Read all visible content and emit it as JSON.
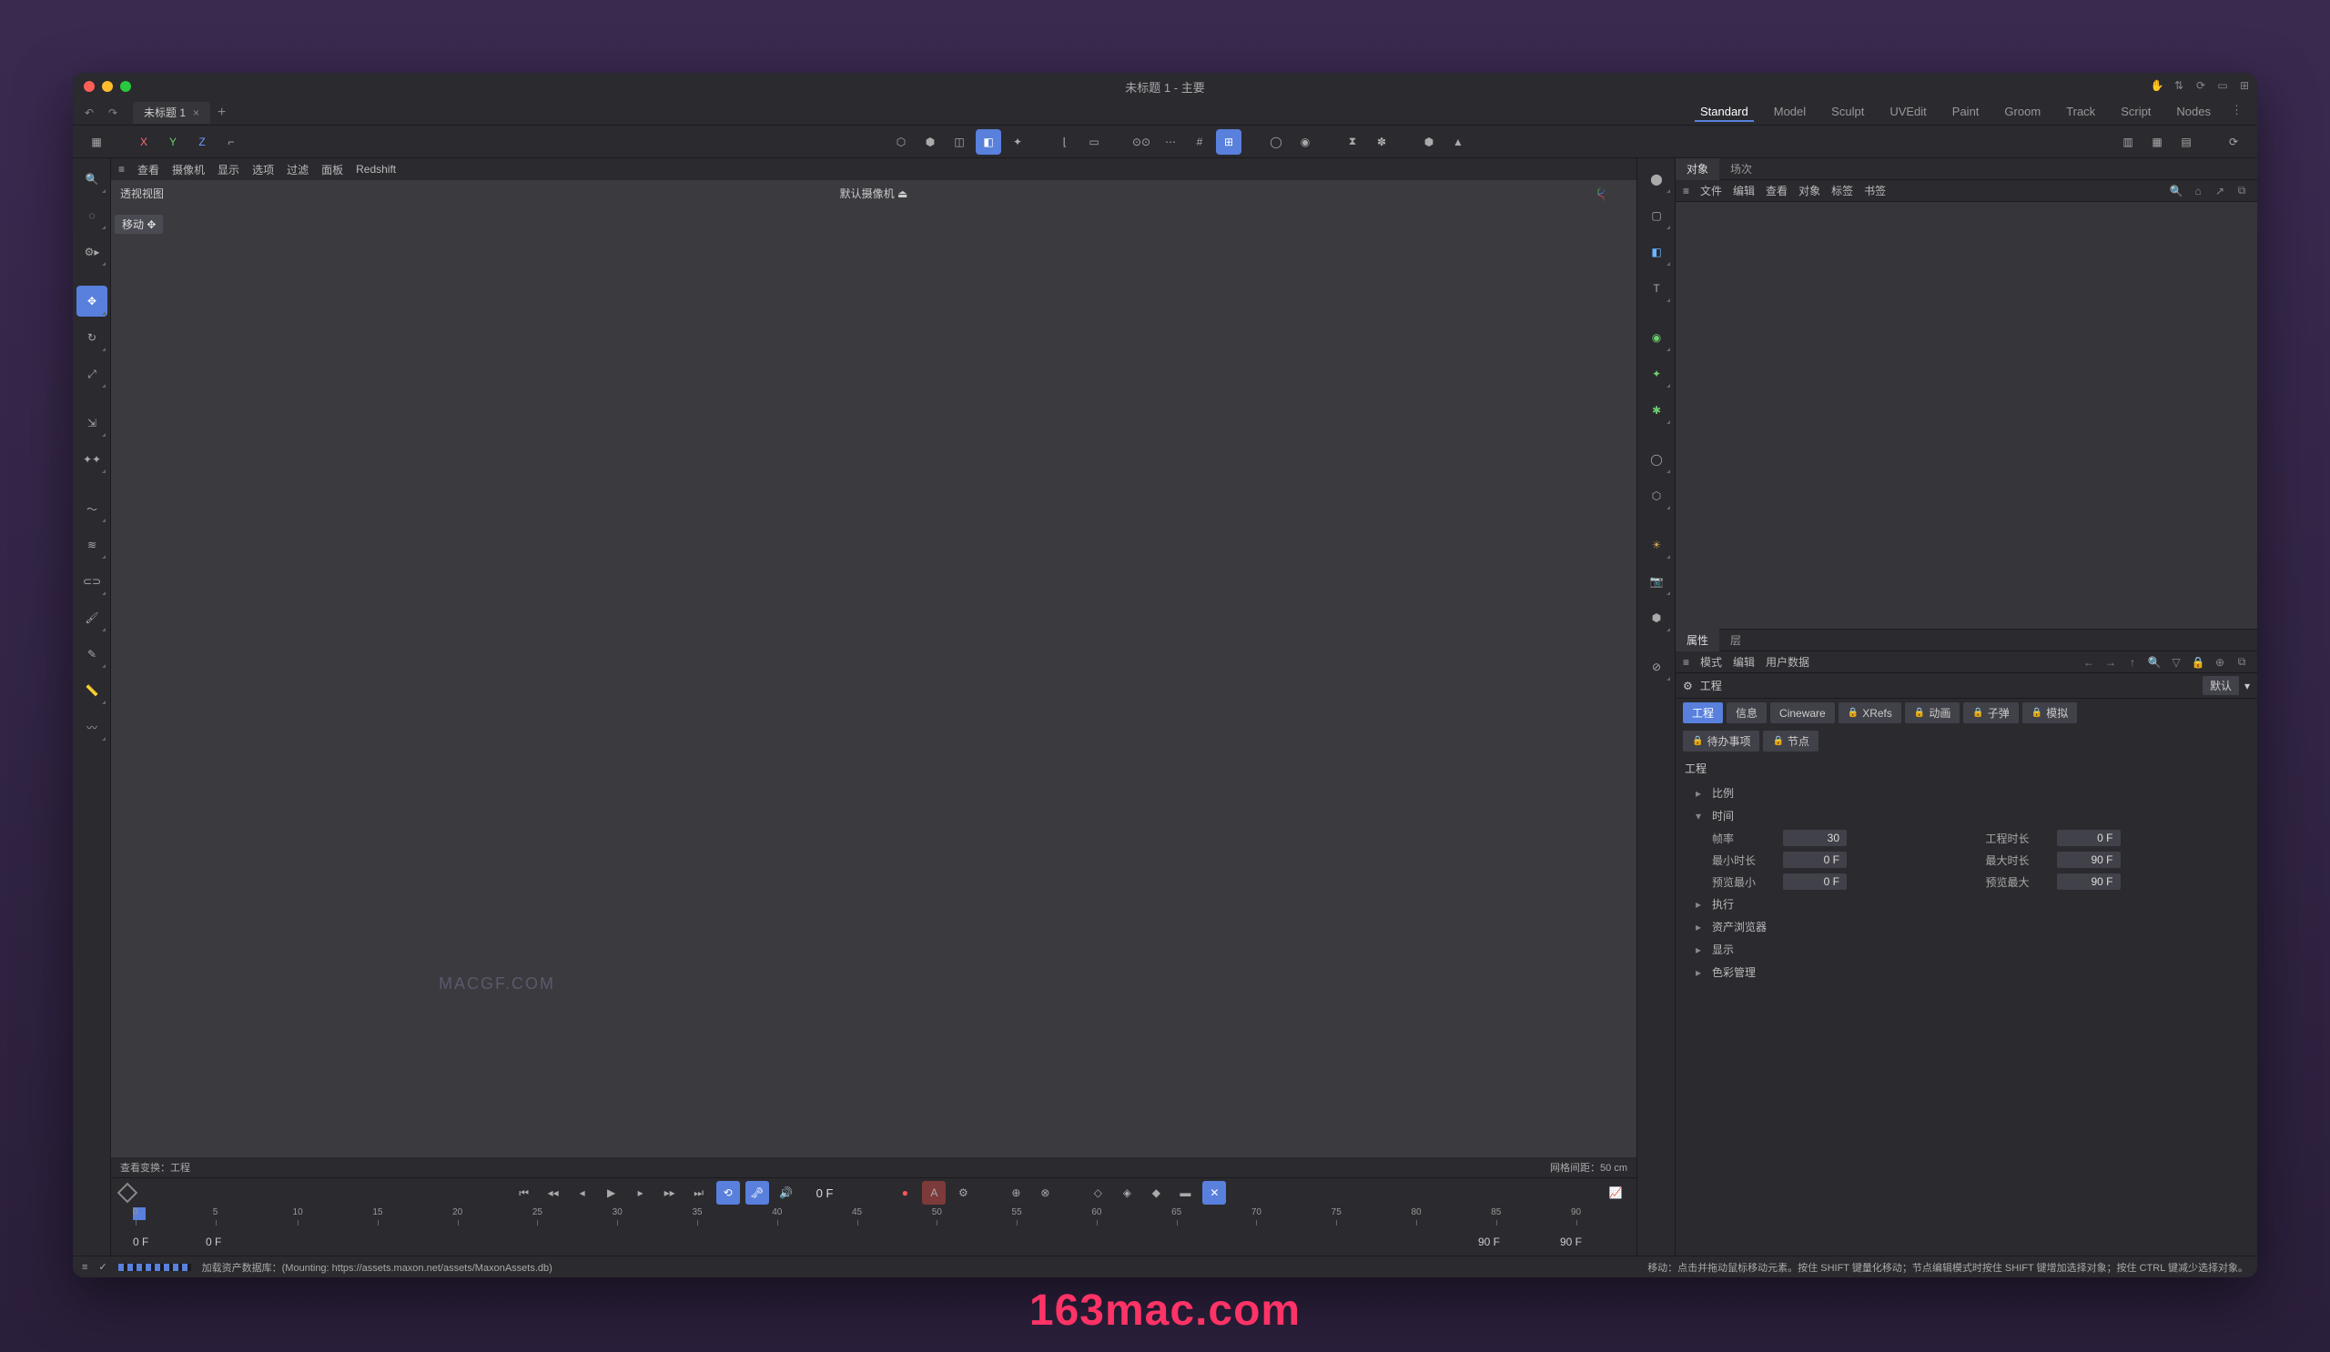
{
  "window": {
    "title": "未标题 1 - 主要"
  },
  "doc_tabs": {
    "tab1": "未标题 1"
  },
  "layouts": [
    "Standard",
    "Model",
    "Sculpt",
    "UVEdit",
    "Paint",
    "Groom",
    "Track",
    "Script",
    "Nodes"
  ],
  "viewport_menu": [
    "查看",
    "摄像机",
    "显示",
    "选项",
    "过滤",
    "面板",
    "Redshift"
  ],
  "viewport": {
    "label": "透视视图",
    "camera": "默认摄像机",
    "move_tag": "移动 ✥",
    "watermark": "MACGF.COM",
    "footer_left": "查看变换：工程",
    "footer_right": "网格间距：50 cm"
  },
  "object_panel": {
    "tabs": [
      "对象",
      "场次"
    ],
    "menu": [
      "文件",
      "编辑",
      "查看",
      "对象",
      "标签",
      "书签"
    ]
  },
  "attrib_panel": {
    "tabs": [
      "属性",
      "层"
    ],
    "menu": [
      "模式",
      "编辑",
      "用户数据"
    ],
    "header_icon_label": "工程",
    "mode": "默认",
    "category_tabs": {
      "project": "工程",
      "info": "信息",
      "cineware": "Cineware",
      "xrefs": "XRefs",
      "anim": "动画",
      "bullet": "子弹",
      "sim": "模拟",
      "todo": "待办事项",
      "nodes": "节点"
    },
    "section_title": "工程",
    "sections": {
      "scale": "比例",
      "time": "时间",
      "execute": "执行",
      "asset_browser": "资产浏览器",
      "display": "显示",
      "color_mgmt": "色彩管理"
    },
    "fields": {
      "fps_label": "帧率",
      "fps": "30",
      "proj_len_label": "工程时长",
      "proj_len": "0 F",
      "min_len_label": "最小时长",
      "min_len": "0 F",
      "max_len_label": "最大时长",
      "max_len": "90 F",
      "preview_min_label": "预览最小",
      "preview_min": "0 F",
      "preview_max_label": "预览最大",
      "preview_max": "90 F"
    }
  },
  "timeline": {
    "current_frame": "0 F",
    "ticks": [
      "0",
      "5",
      "10",
      "15",
      "20",
      "25",
      "30",
      "35",
      "40",
      "45",
      "50",
      "55",
      "60",
      "65",
      "70",
      "75",
      "80",
      "85",
      "90"
    ],
    "range_start": "0 F",
    "range_preview_start": "0 F",
    "range_preview_end": "90 F",
    "range_end": "90 F"
  },
  "status": {
    "loading": "加载资产数据库：(Mounting: https://assets.maxon.net/assets/MaxonAssets.db)",
    "hint": "移动：点击并拖动鼠标移动元素。按住 SHIFT 键量化移动；节点编辑模式时按住 SHIFT 键增加选择对象；按住 CTRL 键减少选择对象。"
  },
  "site_watermark": "163mac.com"
}
